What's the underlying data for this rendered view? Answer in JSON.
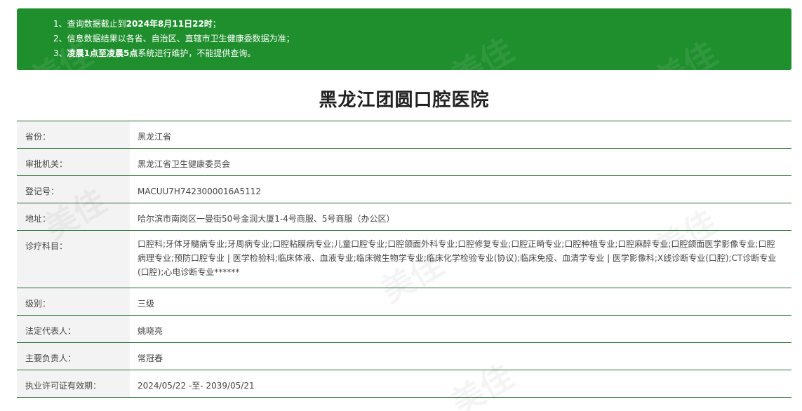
{
  "notice": {
    "line1_prefix": "1、查询数据截止到",
    "line1_bold": "2024年8月11日22时",
    "line1_suffix": "；",
    "line2": "2、信息数据结果以各省、自治区、直辖市卫生健康委数据为准；",
    "line3_prefix": "3、",
    "line3_bold": "凌晨1点至凌晨5点",
    "line3_suffix": "系统进行维护，不能提供查询。"
  },
  "hospital": {
    "title": "黑龙江团圆口腔医院"
  },
  "rows": [
    {
      "label": "省份：",
      "value": "黑龙江省"
    },
    {
      "label": "审批机关：",
      "value": "黑龙江省卫生健康委员会"
    },
    {
      "label": "登记号：",
      "value": "MACUU7H7423000016A5112"
    },
    {
      "label": "地址：",
      "value": "哈尔滨市南岗区一曼街50号金润大厦1-4号商服、5号商服（办公区）"
    },
    {
      "label": "诊疗科目：",
      "value": "口腔科;牙体牙髓病专业;牙周病专业;口腔粘膜病专业;儿童口腔专业;口腔颌面外科专业;口腔修复专业;口腔正畸专业;口腔种植专业;口腔麻醉专业;口腔颌面医学影像专业;口腔病理专业;预防口腔专业 | 医学检验科;临床体液、血液专业;临床微生物学专业;临床化学检验专业(协议);临床免疫、血清学专业 | 医学影像科;X线诊断专业(口腔);CT诊断专业(口腔);心电诊断专业******"
    },
    {
      "label": "级别：",
      "value": "三级"
    },
    {
      "label": "法定代表人：",
      "value": "姚晓亮"
    },
    {
      "label": "主要负责人：",
      "value": "常冠春"
    },
    {
      "label": "执业许可证有效期：",
      "value": "2024/05/22 -至- 2039/05/21"
    }
  ],
  "watermark_text": "美佳"
}
